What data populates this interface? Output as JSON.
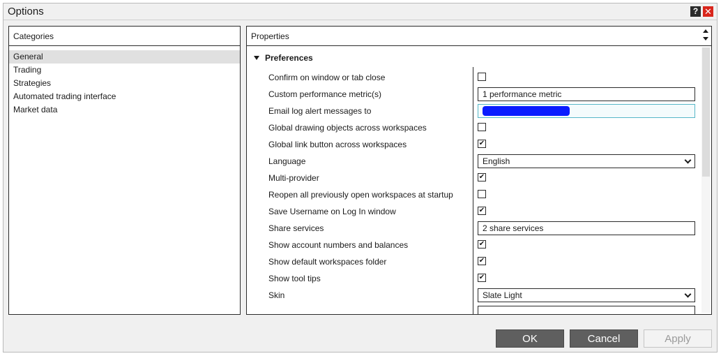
{
  "window": {
    "title": "Options",
    "help_label": "?",
    "close_label": "✕"
  },
  "categories": {
    "header": "Categories",
    "items": [
      {
        "label": "General",
        "selected": true
      },
      {
        "label": "Trading",
        "selected": false
      },
      {
        "label": "Strategies",
        "selected": false
      },
      {
        "label": "Automated trading interface",
        "selected": false
      },
      {
        "label": "Market data",
        "selected": false
      }
    ]
  },
  "properties": {
    "header": "Properties",
    "section": "Preferences",
    "rows": [
      {
        "label": "Confirm on window or tab close",
        "type": "checkbox",
        "checked": false
      },
      {
        "label": "Custom performance metric(s)",
        "type": "text",
        "value": "1 performance metric"
      },
      {
        "label": "Email log alert messages to",
        "type": "email",
        "value": ""
      },
      {
        "label": "Global drawing objects across workspaces",
        "type": "checkbox",
        "checked": false
      },
      {
        "label": "Global link button across workspaces",
        "type": "checkbox",
        "checked": true
      },
      {
        "label": "Language",
        "type": "select",
        "value": "English"
      },
      {
        "label": "Multi-provider",
        "type": "checkbox",
        "checked": true
      },
      {
        "label": "Reopen all previously open workspaces at startup",
        "type": "checkbox",
        "checked": false
      },
      {
        "label": "Save Username on Log In window",
        "type": "checkbox",
        "checked": true
      },
      {
        "label": "Share services",
        "type": "text",
        "value": "2 share services"
      },
      {
        "label": "Show account numbers and balances",
        "type": "checkbox",
        "checked": true
      },
      {
        "label": "Show default workspaces folder",
        "type": "checkbox",
        "checked": true
      },
      {
        "label": "Show tool tips",
        "type": "checkbox",
        "checked": true
      },
      {
        "label": "Skin",
        "type": "select",
        "value": "Slate Light"
      }
    ]
  },
  "buttons": {
    "ok": "OK",
    "cancel": "Cancel",
    "apply": "Apply"
  },
  "colors": {
    "accent_close": "#d9261c",
    "button_dark": "#5f5f5f",
    "focus_border": "#57b7c7"
  }
}
